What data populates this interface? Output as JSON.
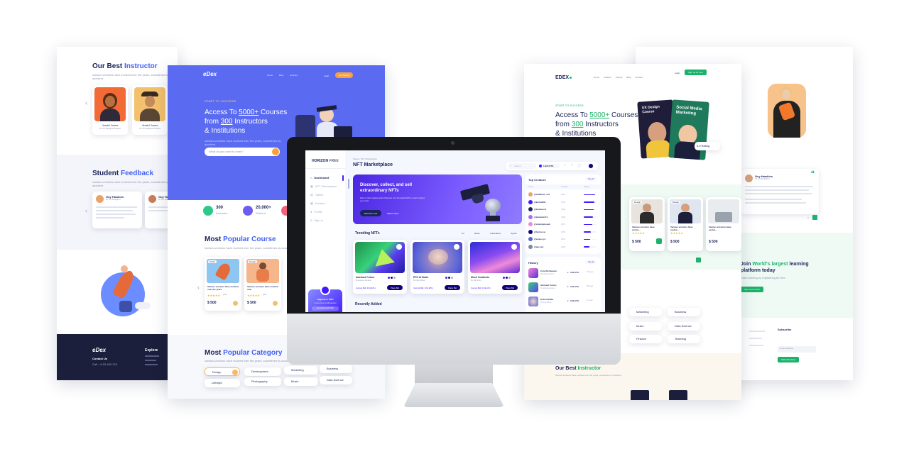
{
  "left_back": {
    "instructors_title_a": "Our Best ",
    "instructors_title_b": "Instructor",
    "sub": "Various versions have evolved over the years, sometimes by accident.",
    "instructors": [
      {
        "name": "Jerald Jones",
        "role": "UI UX Designer Expert"
      },
      {
        "name": "Jerald Jones",
        "role": "UI UX Designer Expert"
      }
    ],
    "feedback_title_a": "Student ",
    "feedback_title_b": "Feedback",
    "reviews": [
      {
        "name": "Guy Hawkins",
        "role": "UI UX Designer"
      },
      {
        "name": "Guy Hawkins",
        "role": "UI UX Designer"
      }
    ],
    "footer_logo": "eDex",
    "footer_contact": "Contact Us",
    "footer_explore": "Explore",
    "footer_phone": "Call : +123 400 123"
  },
  "left_mid": {
    "logo": "eDex",
    "nav": [
      "Home",
      "Blog",
      "Courses"
    ],
    "login": "Login",
    "cta": "Get Started",
    "kicker": "START TO SUCCESS",
    "hero_l1a": "Access To ",
    "hero_l1b": "5000+",
    "hero_l1c": " Courses",
    "hero_l2a": "from ",
    "hero_l2b": "300",
    "hero_l2c": " Instructors",
    "hero_l3": "& Institutions",
    "hero_sub": "Various versions have evolved over the years, sometimes by accident.",
    "search_placeholder": "What do you want to learn?",
    "stats": [
      {
        "value": "300",
        "label": "Instructor"
      },
      {
        "value": "20,000+",
        "label": "Student"
      }
    ],
    "popular_title_a": "Most ",
    "popular_title_b": "Popular Course",
    "popular_sub": "Various versions have evolved over the years, sometimes by accident.",
    "courses": [
      {
        "tag": "UI/UX",
        "title": "Various versions have evolved over the years",
        "price": "$ 500",
        "rating": "(23)"
      },
      {
        "tag": "Design",
        "title": "Various versions have evolved over",
        "price": "$ 500",
        "rating": "(65)"
      }
    ],
    "category_title_a": "Most ",
    "category_title_b": "Popular Category",
    "category_sub": "Various versions have evolved over the years, sometimes by accident.",
    "categories": [
      "Design",
      "Development",
      "Marketing",
      "Business",
      "Lifestyle",
      "Photography",
      "Music",
      "Data Science"
    ]
  },
  "right_mid": {
    "logo": "EDEX",
    "nav": [
      "Home",
      "Careers",
      "Course",
      "Blog",
      "Contact"
    ],
    "login": "Login",
    "cta": "Sign up for free",
    "kicker": "START TO SUCCESS",
    "hero_l1a": "Access To ",
    "hero_l1b": "5000+",
    "hero_l1c": " Courses",
    "hero_l2a": "from ",
    "hero_l2b": "300",
    "hero_l2c": " Instructors",
    "hero_l3": "& Institutions",
    "book1": "UX Design Course",
    "book2": "Social Media Marketing",
    "badge": "5.0 Rating",
    "courses": [
      {
        "tag": "Design",
        "price": "$ 500",
        "rating": "(65)"
      },
      {
        "tag": "Design",
        "price": "$ 500",
        "rating": "(65)"
      },
      {
        "tag": "Design",
        "price": "$ 500",
        "rating": "(65)"
      },
      {
        "tag": "Design",
        "price": "$ 500",
        "rating": "(65)"
      }
    ],
    "course_title": "Various versions have evolve...",
    "categories": [
      "Marketing",
      "Business",
      "Music",
      "Data Science",
      "Finance",
      "Teaching"
    ],
    "instructor_title_a": "Our Best ",
    "instructor_title_b": "Instructor",
    "instructor_sub": "Various versions have evolved over the years, sometimes by accident."
  },
  "right_back": {
    "reviewer": "Guy Hawkins",
    "role": "UI UX Designer",
    "join_a": "Join ",
    "join_b": "World's largest",
    "join_c": " learning platform today",
    "join_sub": "Start learning by registering for free",
    "join_btn": "Sign Up for Free",
    "subscribe": "Subscribe",
    "email_placeholder": "Email Address",
    "subscribe_btn": "Subscribe Now"
  },
  "dashboard": {
    "brand_a": "HORIZON ",
    "brand_b": "FREE",
    "breadcrumb": "Pages / NFT Marketplace",
    "title": "NFT Marketplace",
    "search_placeholder": "Search",
    "balance": "1.924 ETH",
    "nav": [
      "Dashboard",
      "NFT Marketplace",
      "Tables",
      "Kanban",
      "Profile",
      "Sign In"
    ],
    "banner_title": "Discover, collect, and sell extraordinary NFTs",
    "banner_sub": "Enter in this creative world. Discover now the latest NFTs or start creating your own!",
    "discover_btn": "Discover now",
    "watch_btn": "Watch video",
    "trending": "Trending NFTs",
    "filters": [
      "Art",
      "Music",
      "Collectibles",
      "Sports"
    ],
    "nfts": [
      {
        "name": "Abstract Colors",
        "author": "By Esthera Jackson",
        "bid": "Current Bid: 0.91 ETH",
        "btn": "Place Bid"
      },
      {
        "name": "ETH AI Brain",
        "author": "By Nick Wilson",
        "bid": "Current Bid: 0.91 ETH",
        "btn": "Place Bid"
      },
      {
        "name": "Mesh Gradients",
        "author": "By Will Smith",
        "bid": "Current Bid: 0.91 ETH",
        "btn": "Place Bid"
      }
    ],
    "recent": "Recently Added",
    "top_creators": "Top Creators",
    "see_all": "See all",
    "creator_cols": [
      "Name",
      "Artworks",
      "Rating"
    ],
    "creators": [
      {
        "name": "@maddison_c21",
        "count": "9821"
      },
      {
        "name": "@karl.will02",
        "count": "7032"
      },
      {
        "name": "@andreea.1z",
        "count": "5204"
      },
      {
        "name": "@abraham47.y",
        "count": "4309"
      },
      {
        "name": "@simmmple.web",
        "count": "3871"
      },
      {
        "name": "@horizon.ui",
        "count": "3152"
      },
      {
        "name": "@venus.sys",
        "count": "2907"
      },
      {
        "name": "@ape.vpn",
        "count": "2309"
      }
    ],
    "history": "History",
    "history_items": [
      {
        "name": "Colorful Heaven",
        "author": "By Mark Benjamin",
        "price": "0.91 ETH",
        "time": "30s ago"
      },
      {
        "name": "Abstract Colors",
        "author": "By Esthera Jackson",
        "price": "0.91 ETH",
        "time": "58s ago"
      },
      {
        "name": "ETH AI Brain",
        "author": "By Nick Wilson",
        "price": "0.91 ETH",
        "time": "1m ago"
      }
    ],
    "upgrade_title": "Upgrade to PRO",
    "upgrade_sub": "to get access to all features!",
    "upgrade_btn": "Get started with PRO"
  }
}
